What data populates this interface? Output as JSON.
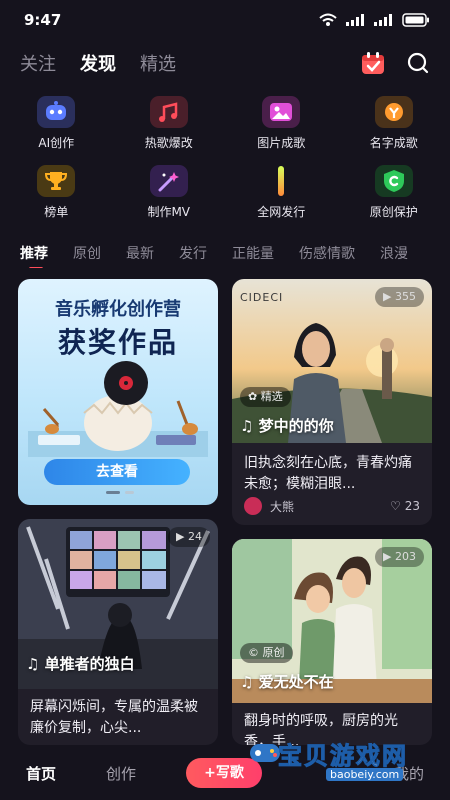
{
  "status": {
    "time": "9:47"
  },
  "topnav": {
    "tabs": [
      {
        "label": "关注"
      },
      {
        "label": "发现"
      },
      {
        "label": "精选"
      }
    ]
  },
  "features": [
    {
      "label": "AI创作",
      "icon": "ai-robot-icon",
      "color": "#5b7cff"
    },
    {
      "label": "热歌爆改",
      "icon": "hot-music-icon",
      "color": "#ff4d5a"
    },
    {
      "label": "图片成歌",
      "icon": "image-icon",
      "color": "#e14fd8"
    },
    {
      "label": "名字成歌",
      "icon": "name-song-icon",
      "color": "#ff9b2f"
    },
    {
      "label": "榜单",
      "icon": "trophy-icon",
      "color": "#ffb020"
    },
    {
      "label": "制作MV",
      "icon": "magic-wand-icon",
      "color": "#9b5cff"
    },
    {
      "label": "全网发行",
      "icon": "release-bar-icon",
      "color": "#b7f04a"
    },
    {
      "label": "原创保护",
      "icon": "shield-c-icon",
      "color": "#2ec95a"
    }
  ],
  "categories": [
    "推荐",
    "原创",
    "最新",
    "发行",
    "正能量",
    "伤感情歌",
    "浪漫"
  ],
  "banner": {
    "line1": "音乐孵化创作营",
    "line2": "获奖作品",
    "button": "去查看"
  },
  "cards": [
    {
      "plays": "355",
      "badge": "精选",
      "title": "梦中的的你",
      "desc": "旧执念刻在心底，青春灼痛未愈；模糊泪眼...",
      "author": "大熊",
      "likes": "23",
      "img_text": "CIDECI"
    },
    {
      "plays": "24",
      "title": "单推者的独白",
      "desc": "屏幕闪烁间，专属的温柔被廉价复制，心尖..."
    },
    {
      "plays": "203",
      "badge": "原创",
      "title": "爱无处不在",
      "desc": "翻身时的呼吸，厨房的光香，手..."
    }
  ],
  "bottom_nav": {
    "home": "首页",
    "create": "创作",
    "write": "+写歌",
    "mine": "我的"
  },
  "watermark": {
    "main": "宝贝游戏网",
    "sub": "baobeiy.com"
  },
  "colors": {
    "accent": "#ff4d5a",
    "background": "#15131d",
    "card": "#211e29"
  }
}
